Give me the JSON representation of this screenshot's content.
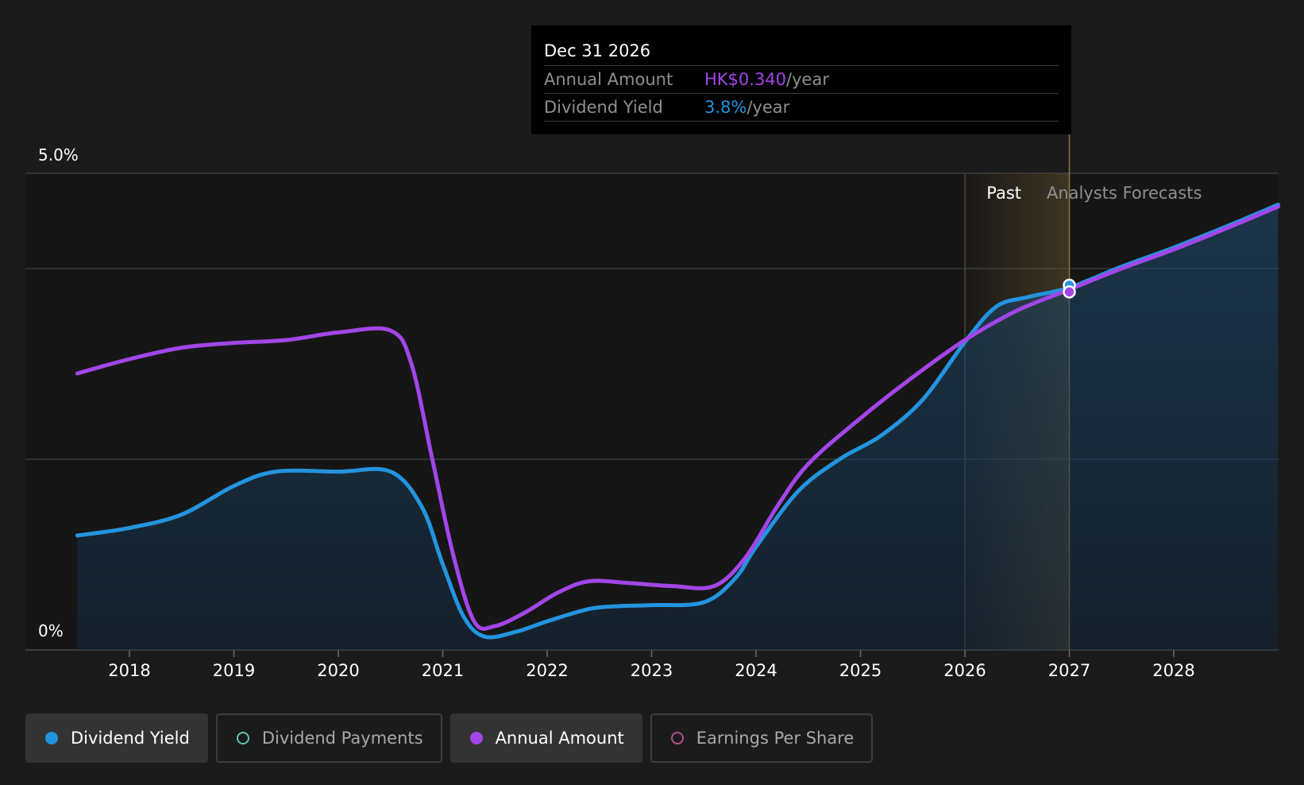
{
  "chart_data": {
    "type": "line",
    "x_ticks": [
      "2018",
      "2019",
      "2020",
      "2021",
      "2022",
      "2023",
      "2024",
      "2025",
      "2026",
      "2027",
      "2028"
    ],
    "y_tick_labels": {
      "top": "5.0%",
      "bottom": "0%"
    },
    "ylim": [
      0,
      5.0
    ],
    "grid": true,
    "regions": {
      "past_label": "Past",
      "forecast_label": "Analysts Forecasts"
    },
    "series": [
      {
        "name": "Dividend Yield",
        "color": "#2394df",
        "points": [
          [
            2017.5,
            1.2
          ],
          [
            2018.0,
            1.28
          ],
          [
            2018.5,
            1.42
          ],
          [
            2019.0,
            1.72
          ],
          [
            2019.4,
            1.87
          ],
          [
            2020.0,
            1.87
          ],
          [
            2020.5,
            1.87
          ],
          [
            2020.8,
            1.5
          ],
          [
            2021.0,
            0.9
          ],
          [
            2021.2,
            0.35
          ],
          [
            2021.4,
            0.14
          ],
          [
            2021.7,
            0.19
          ],
          [
            2022.0,
            0.3
          ],
          [
            2022.4,
            0.43
          ],
          [
            2022.7,
            0.46
          ],
          [
            2023.0,
            0.47
          ],
          [
            2023.5,
            0.5
          ],
          [
            2023.8,
            0.75
          ],
          [
            2024.0,
            1.08
          ],
          [
            2024.4,
            1.66
          ],
          [
            2024.8,
            2.0
          ],
          [
            2025.2,
            2.25
          ],
          [
            2025.6,
            2.63
          ],
          [
            2026.0,
            3.23
          ],
          [
            2026.3,
            3.6
          ],
          [
            2026.6,
            3.7
          ],
          [
            2027.0,
            3.8
          ],
          [
            2027.5,
            4.02
          ],
          [
            2028.0,
            4.22
          ],
          [
            2028.5,
            4.44
          ],
          [
            2029.0,
            4.67
          ]
        ]
      },
      {
        "name": "Annual Amount",
        "color": "#a246e8",
        "points": [
          [
            2017.5,
            2.9
          ],
          [
            2018.0,
            3.05
          ],
          [
            2018.5,
            3.17
          ],
          [
            2019.0,
            3.22
          ],
          [
            2019.5,
            3.25
          ],
          [
            2020.0,
            3.33
          ],
          [
            2020.5,
            3.35
          ],
          [
            2020.7,
            3.0
          ],
          [
            2020.9,
            2.0
          ],
          [
            2021.1,
            1.0
          ],
          [
            2021.3,
            0.3
          ],
          [
            2021.5,
            0.25
          ],
          [
            2021.8,
            0.4
          ],
          [
            2022.1,
            0.6
          ],
          [
            2022.4,
            0.72
          ],
          [
            2022.8,
            0.7
          ],
          [
            2023.2,
            0.67
          ],
          [
            2023.6,
            0.67
          ],
          [
            2023.9,
            0.97
          ],
          [
            2024.2,
            1.5
          ],
          [
            2024.5,
            1.95
          ],
          [
            2025.0,
            2.43
          ],
          [
            2025.5,
            2.86
          ],
          [
            2026.0,
            3.25
          ],
          [
            2026.5,
            3.56
          ],
          [
            2027.0,
            3.78
          ],
          [
            2027.5,
            4.0
          ],
          [
            2028.0,
            4.2
          ],
          [
            2028.5,
            4.42
          ],
          [
            2029.0,
            4.65
          ]
        ]
      }
    ],
    "markers": [
      {
        "series": "Dividend Yield",
        "x": 2027.0,
        "y": 3.8
      },
      {
        "series": "Annual Amount",
        "x": 2027.0,
        "y": 3.78
      }
    ]
  },
  "tooltip": {
    "date": "Dec 31 2026",
    "rows": [
      {
        "label": "Annual Amount",
        "value": "HK$0.340",
        "unit": "/year",
        "color": "#a246e8"
      },
      {
        "label": "Dividend Yield",
        "value": "3.8%",
        "unit": "/year",
        "color": "#2394df"
      }
    ]
  },
  "legend": [
    {
      "label": "Dividend Yield",
      "color": "#2394df",
      "active": true,
      "marker": "filled"
    },
    {
      "label": "Dividend Payments",
      "color": "#5ec4b8",
      "active": false,
      "marker": "hollow"
    },
    {
      "label": "Annual Amount",
      "color": "#a246e8",
      "active": true,
      "marker": "filled"
    },
    {
      "label": "Earnings Per Share",
      "color": "#b34e8e",
      "active": false,
      "marker": "hollow"
    }
  ]
}
